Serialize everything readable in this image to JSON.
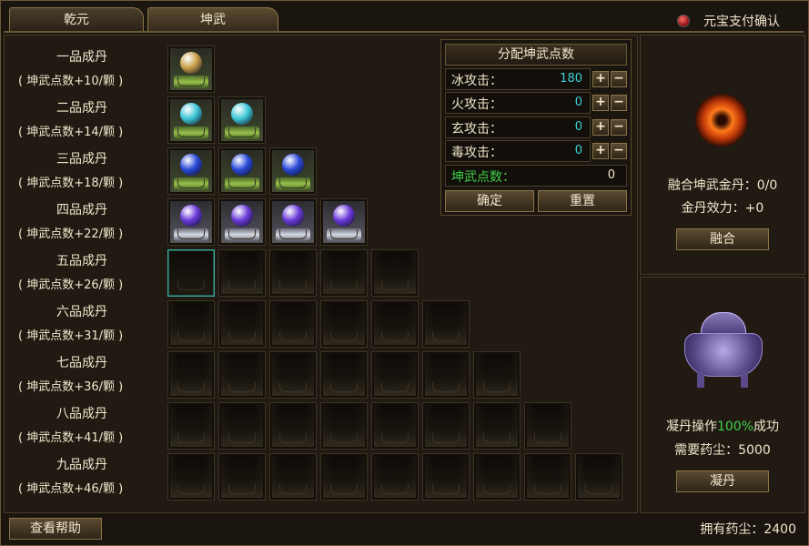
{
  "tabs": [
    {
      "label": "乾元",
      "active": false
    },
    {
      "label": "坤武",
      "active": true
    }
  ],
  "payment_confirm": {
    "label": "元宝支付确认",
    "icon": "red-dot-icon"
  },
  "grades": [
    {
      "name": "一品成丹",
      "points": "( 坤武点数+10/颗 )",
      "filled": 1,
      "orb_color": "#c9a04a"
    },
    {
      "name": "二品成丹",
      "points": "( 坤武点数+14/颗 )",
      "filled": 2,
      "orb_color": "#3fc8d8"
    },
    {
      "name": "三品成丹",
      "points": "( 坤武点数+18/颗 )",
      "filled": 3,
      "orb_color": "#2a4ad8"
    },
    {
      "name": "四品成丹",
      "points": "( 坤武点数+22/颗 )",
      "filled": 4,
      "orb_color": "#6a3ad8"
    },
    {
      "name": "五品成丹",
      "points": "( 坤武点数+26/颗 )",
      "filled": 0,
      "orb_color": ""
    },
    {
      "name": "六品成丹",
      "points": "( 坤武点数+31/颗 )",
      "filled": 0,
      "orb_color": ""
    },
    {
      "name": "七品成丹",
      "points": "( 坤武点数+36/颗 )",
      "filled": 0,
      "orb_color": ""
    },
    {
      "name": "八品成丹",
      "points": "( 坤武点数+41/颗 )",
      "filled": 0,
      "orb_color": ""
    },
    {
      "name": "九品成丹",
      "points": "( 坤武点数+46/颗 )",
      "filled": 0,
      "orb_color": ""
    }
  ],
  "allocation": {
    "title": "分配坤武点数",
    "attributes": [
      {
        "label": "冰攻击：",
        "value": "180"
      },
      {
        "label": "火攻击：",
        "value": "0"
      },
      {
        "label": "玄攻击：",
        "value": "0"
      },
      {
        "label": "毒攻击：",
        "value": "0"
      }
    ],
    "plus": "+",
    "minus": "−",
    "points_label": "坤武点数：",
    "points_value": "0",
    "confirm": "确定",
    "reset": "重置"
  },
  "fusion": {
    "gold_pill": "融合坤武金丹：0/0",
    "effect": "金丹效力：+0",
    "button": "融合"
  },
  "condense": {
    "prefix": "凝丹操作",
    "rate": "100%",
    "suffix": "成功",
    "cost": "需要药尘：5000",
    "button": "凝丹"
  },
  "footer": {
    "help": "查看帮助",
    "owned": "拥有药尘：2400"
  },
  "colors": {
    "accent_green": "#3fd04a",
    "value_cyan": "#3fd0d8",
    "border_gold": "#8a7448"
  }
}
